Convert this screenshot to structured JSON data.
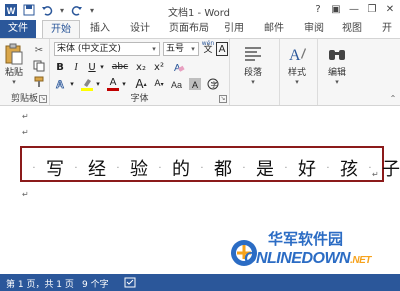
{
  "title_bar": {
    "document_title": "文档1 - Word",
    "icons": [
      "word-logo-icon",
      "save-icon",
      "undo-icon",
      "redo-icon",
      "help-icon",
      "minimize-icon",
      "restore-icon",
      "close-icon"
    ]
  },
  "tabs": {
    "file": "文件",
    "items": [
      "开始",
      "插入",
      "设计",
      "页面布局",
      "引用",
      "邮件",
      "审阅",
      "视图",
      "开"
    ],
    "active": "开始"
  },
  "ribbon": {
    "clipboard": {
      "paste_label": "粘贴",
      "group_label": "剪贴板"
    },
    "font": {
      "font_name": "宋体 (中文正文)",
      "font_size": "五号",
      "wen_label": "wén",
      "a_label": "A",
      "bold": "B",
      "italic": "I",
      "underline": "U",
      "strikethrough": "abc",
      "subscript": "x₂",
      "superscript": "x²",
      "font_color": "A",
      "grow": "A",
      "shrink": "A",
      "group_label": "字体"
    },
    "paragraph": {
      "label": "段落"
    },
    "styles": {
      "label": "样式"
    },
    "editing": {
      "label": "编辑"
    }
  },
  "document": {
    "characters": [
      "写",
      "经",
      "验",
      "的",
      "都",
      "是",
      "好",
      "孩",
      "子"
    ],
    "box_color": "#8b1a1a"
  },
  "status_bar": {
    "page": "第 1 页，共 1 页",
    "words": "9 个字"
  },
  "watermark": {
    "line1": "华军软件园",
    "line2": "ONLINEDOWN",
    "suffix": ".NET"
  },
  "colors": {
    "accent": "#2b579a",
    "status_bar": "#2b579a",
    "highlight": "#ffff00",
    "font_color": "#c00000"
  }
}
